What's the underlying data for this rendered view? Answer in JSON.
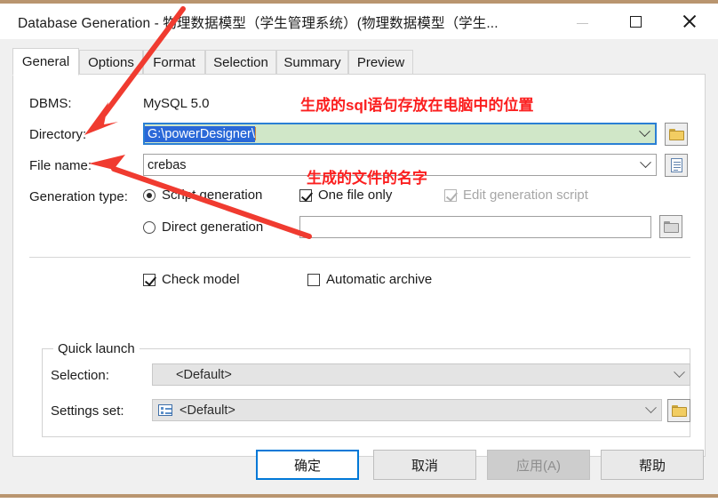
{
  "window": {
    "title": "Database Generation - 物理数据模型（学生管理系统）(物理数据模型（学生...",
    "minimize_label": "minimize",
    "maximize_label": "maximize",
    "close_label": "close"
  },
  "tabs": [
    {
      "label": "General",
      "active": true
    },
    {
      "label": "Options",
      "active": false
    },
    {
      "label": "Format",
      "active": false
    },
    {
      "label": "Selection",
      "active": false
    },
    {
      "label": "Summary",
      "active": false
    },
    {
      "label": "Preview",
      "active": false
    }
  ],
  "form": {
    "dbms_label": "DBMS:",
    "dbms_value": "MySQL 5.0",
    "directory_label": "Directory:",
    "directory_value": "G:\\powerDesigner\\",
    "filename_label": "File name:",
    "filename_value": "crebas",
    "generation_type_label": "Generation type:",
    "script_generation_label": "Script generation",
    "script_generation_checked": true,
    "direct_generation_label": "Direct generation",
    "direct_generation_checked": false,
    "one_file_only_label": "One file only",
    "one_file_only_checked": true,
    "edit_generation_script_label": "Edit generation script",
    "edit_generation_script_checked": true,
    "edit_generation_script_disabled": true,
    "direct_generation_field_value": "",
    "check_model_label": "Check model",
    "check_model_checked": true,
    "automatic_archive_label": "Automatic archive",
    "automatic_archive_checked": false
  },
  "quick_launch": {
    "group_title": "Quick launch",
    "selection_label": "Selection:",
    "selection_value": "<Default>",
    "settings_set_label": "Settings set:",
    "settings_set_value": "<Default>"
  },
  "buttons": {
    "ok": "确定",
    "cancel": "取消",
    "apply": "应用(A)",
    "help": "帮助"
  },
  "annotations": [
    {
      "text": "生成的sql语句存放在电脑中的位置"
    },
    {
      "text": "生成的文件的名字"
    }
  ],
  "icons": {
    "directory_browse": "folder-icon",
    "filename_browse": "document-icon",
    "script_browse": "folder-disabled-icon",
    "settings_browse": "folder-icon",
    "settings_set_prefix": "list-settings-icon"
  },
  "colors": {
    "accent": "#0078d7",
    "annotation": "#fb1f1f",
    "focused_field_bg": "#d0e7c8",
    "selection_bg": "#2a68d8",
    "window_edge": "#b9956f"
  }
}
